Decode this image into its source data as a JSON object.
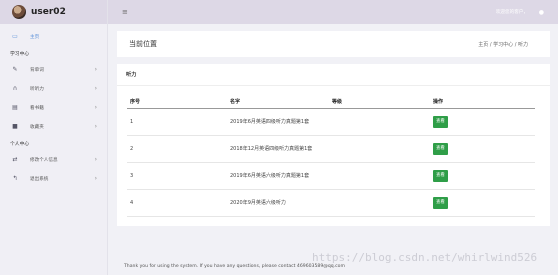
{
  "brand": {
    "username": "user02"
  },
  "topbar": {
    "welcome": "欢迎您的客户，"
  },
  "sidebar": {
    "home": "主页",
    "section_learning": "学习中心",
    "items_learning": [
      {
        "label": "背单词",
        "icon": "edit-icon"
      },
      {
        "label": "听听力",
        "icon": "headphones-icon"
      },
      {
        "label": "看书籍",
        "icon": "book-icon"
      },
      {
        "label": "收藏夹",
        "icon": "folder-icon"
      }
    ],
    "section_personal": "个人中心",
    "items_personal": [
      {
        "label": "修改个人信息",
        "icon": "swap-icon"
      },
      {
        "label": "退出系统",
        "icon": "logout-icon"
      }
    ]
  },
  "breadcrumb": {
    "title": "当前位置",
    "path": "主页 / 学习中心 / 听力"
  },
  "panel": {
    "title": "听力",
    "headers": {
      "no": "序号",
      "name": "名字",
      "level": "等级",
      "action": "操作"
    },
    "rows": [
      {
        "no": "1",
        "name": "2019年6月英语四级听力真题第1套",
        "level": "",
        "action": "查看"
      },
      {
        "no": "2",
        "name": "2018年12月英语四级听力真题第1套",
        "level": "",
        "action": "查看"
      },
      {
        "no": "3",
        "name": "2019年6月英语六级听力真题第1套",
        "level": "",
        "action": "查看"
      },
      {
        "no": "4",
        "name": "2020年9月英语六级听力",
        "level": "",
        "action": "查看"
      }
    ]
  },
  "footer": "Thank you for using the system. If you have any questions, please contact 469603589@qq.com",
  "watermark": "https://blog.csdn.net/whirlwind526",
  "colors": {
    "accent": "#5a8fd8",
    "view_button": "#2f9e48",
    "topbar": "#ddd8e6"
  }
}
